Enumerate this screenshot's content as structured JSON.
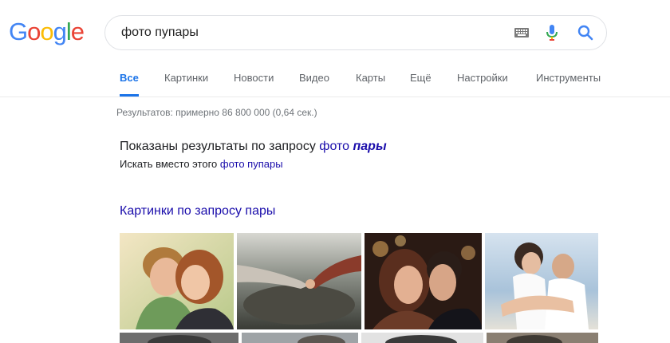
{
  "logo": {
    "text": "Google",
    "letters": [
      {
        "ch": "G",
        "color": "#4285F4"
      },
      {
        "ch": "o",
        "color": "#EA4335"
      },
      {
        "ch": "o",
        "color": "#FBBC05"
      },
      {
        "ch": "g",
        "color": "#4285F4"
      },
      {
        "ch": "l",
        "color": "#34A853"
      },
      {
        "ch": "e",
        "color": "#EA4335"
      }
    ]
  },
  "search": {
    "query": "фото пупары",
    "icons": [
      "keyboard-icon",
      "microphone-icon",
      "search-icon"
    ]
  },
  "tabs": [
    {
      "label": "Все",
      "active": true
    },
    {
      "label": "Картинки",
      "active": false
    },
    {
      "label": "Новости",
      "active": false
    },
    {
      "label": "Видео",
      "active": false
    },
    {
      "label": "Карты",
      "active": false
    },
    {
      "label": "Ещё",
      "active": false
    },
    {
      "label": "Настройки",
      "active": false
    },
    {
      "label": "Инструменты",
      "active": false
    }
  ],
  "stats": "Результатов: примерно 86 800 000 (0,64 сек.)",
  "correction": {
    "prefix": "Показаны результаты по запросу",
    "link_plain": "фото",
    "link_bold": "пары"
  },
  "instead": {
    "prefix": "Искать вместо этого",
    "link": "фото пупары"
  },
  "images_heading": "Картинки по запросу пары",
  "colors": {
    "accent": "#1a73e8",
    "link": "#1a0dab",
    "muted": "#70757a",
    "tab_text": "#5f6368"
  }
}
